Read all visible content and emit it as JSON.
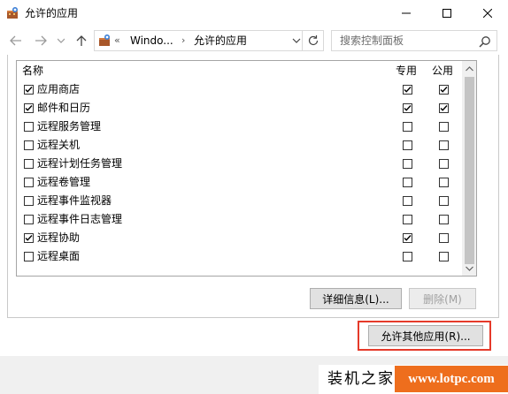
{
  "window": {
    "title": "允许的应用"
  },
  "address": {
    "prefix": "«",
    "crumb1": "Windo...",
    "sep": "›",
    "crumb2": "允许的应用"
  },
  "search": {
    "placeholder": "搜索控制面板"
  },
  "list": {
    "headers": {
      "name": "名称",
      "private": "专用",
      "public": "公用"
    },
    "rows": [
      {
        "name": "应用商店",
        "enabled": true,
        "private": true,
        "public": true
      },
      {
        "name": "邮件和日历",
        "enabled": true,
        "private": true,
        "public": true
      },
      {
        "name": "远程服务管理",
        "enabled": false,
        "private": false,
        "public": false
      },
      {
        "name": "远程关机",
        "enabled": false,
        "private": false,
        "public": false
      },
      {
        "name": "远程计划任务管理",
        "enabled": false,
        "private": false,
        "public": false
      },
      {
        "name": "远程卷管理",
        "enabled": false,
        "private": false,
        "public": false
      },
      {
        "name": "远程事件监视器",
        "enabled": false,
        "private": false,
        "public": false
      },
      {
        "name": "远程事件日志管理",
        "enabled": false,
        "private": false,
        "public": false
      },
      {
        "name": "远程协助",
        "enabled": true,
        "private": true,
        "public": false
      },
      {
        "name": "远程桌面",
        "enabled": false,
        "private": false,
        "public": false
      }
    ]
  },
  "buttons": {
    "details": "详细信息(L)...",
    "remove": "删除(M)",
    "allow_other": "允许其他应用(R)..."
  },
  "watermark": {
    "text": "装机之家",
    "url": "www.lotpc.com"
  },
  "colors": {
    "highlight_border": "#e53a2a",
    "watermark_bg": "#ee6e1d"
  }
}
